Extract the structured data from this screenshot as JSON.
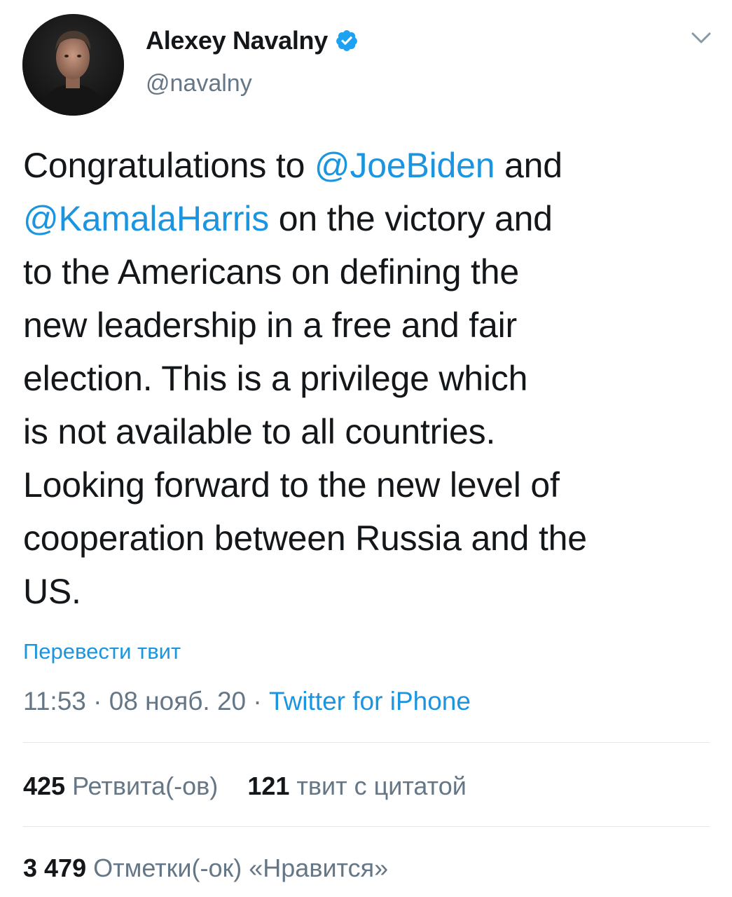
{
  "tweet": {
    "author": {
      "display_name": "Alexey Navalny",
      "handle": "@navalny",
      "verified": true,
      "avatar_icon": "avatar-photo"
    },
    "menu_icon": "chevron-down-icon",
    "text_lines": [
      {
        "segments": [
          {
            "text": "Congratulations to ",
            "mention": false
          },
          {
            "text": "@JoeBiden",
            "mention": true
          },
          {
            "text": " and",
            "mention": false
          }
        ]
      },
      {
        "segments": [
          {
            "text": "@KamalaHarris",
            "mention": true
          },
          {
            "text": " on the victory and",
            "mention": false
          }
        ]
      },
      {
        "segments": [
          {
            "text": "to the Americans on defining the",
            "mention": false
          }
        ]
      },
      {
        "segments": [
          {
            "text": "new leadership in a free and fair",
            "mention": false
          }
        ]
      },
      {
        "segments": [
          {
            "text": "election. This is a privilege which",
            "mention": false
          }
        ]
      },
      {
        "segments": [
          {
            "text": "is not available to all countries.",
            "mention": false
          }
        ]
      },
      {
        "segments": [
          {
            "text": "Looking forward to the new level of",
            "mention": false
          }
        ]
      },
      {
        "segments": [
          {
            "text": "cooperation between Russia and the",
            "mention": false
          }
        ]
      },
      {
        "segments": [
          {
            "text": "US.",
            "mention": false
          }
        ]
      }
    ],
    "translate_label": "Перевести твит",
    "time": "11:53",
    "separator": "·",
    "date": "08 нояб. 20",
    "source": "Twitter for iPhone",
    "stats": {
      "retweets_count": "425",
      "retweets_label": "Ретвита(-ов)",
      "quotes_count": "121",
      "quotes_label": "твит с цитатой",
      "likes_count": "3 479",
      "likes_label": "Отметки(-ок) «Нравится»"
    }
  },
  "colors": {
    "link": "#1b95e0",
    "text": "#14171a",
    "secondary": "#657786",
    "divider": "#e1e8ed",
    "verified": "#1da1f2"
  }
}
